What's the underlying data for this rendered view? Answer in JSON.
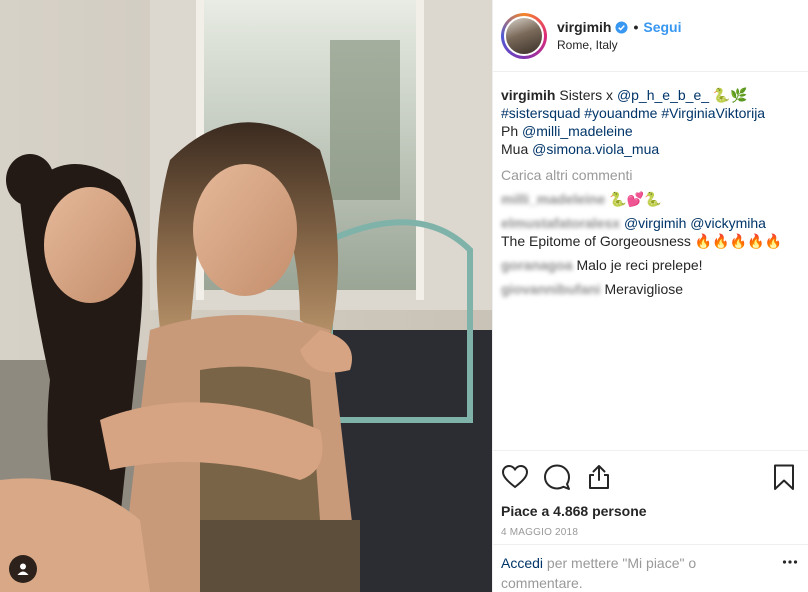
{
  "post": {
    "username": "virgimih",
    "follow_label": "Segui",
    "separator": "•",
    "location": "Rome, Italy",
    "verified_icon": "verified-badge-icon",
    "accent_color": "#3897f0",
    "link_color": "#003569"
  },
  "caption": {
    "user": "virgimih",
    "text1": "Sisters x",
    "mention1": "@p_h_e_b_e_",
    "emoji1": "🐍🌿",
    "hashtags": "#sistersquad #youandme #VirginiaViktorija",
    "ph_label": "Ph",
    "mention2": "@milli_madeleine",
    "mua_label": "Mua",
    "mention3": "@simona.viola_mua"
  },
  "load_more": "Carica altri commenti",
  "comments": [
    {
      "user": "milli_madeleine",
      "text": "🐍💕🐍",
      "mentions": ""
    },
    {
      "user": "elmustafatoralesx",
      "text": "The Epitome of Gorgeousness 🔥🔥🔥🔥🔥",
      "mentions": "@virgimih @vickymiha"
    },
    {
      "user": "goranagoa",
      "text": "Malo je reci prelepe!",
      "mentions": ""
    },
    {
      "user": "giovannibufani",
      "text": "Meravigliose",
      "mentions": ""
    }
  ],
  "likes": "Piace a 4.868 persone",
  "date": "4 MAGGIO 2018",
  "add_comment": {
    "login_link": "Accedi",
    "text": " per mettere \"Mi piace\" o commentare."
  },
  "icons": [
    "heart-icon",
    "comment-icon",
    "share-icon",
    "bookmark-icon",
    "more-options-icon",
    "user-tag-icon"
  ]
}
